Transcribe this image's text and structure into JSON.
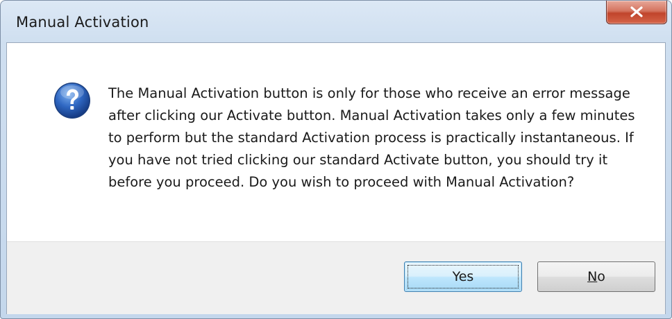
{
  "window": {
    "title": "Manual Activation"
  },
  "dialog": {
    "icon": "question-icon",
    "message": "The Manual Activation button is only for those who receive an error message after clicking our Activate button. Manual Activation takes only a few minutes to perform but the standard Activation process is practically instantaneous. If you have not tried clicking our standard Activate button, you should try it before you proceed. Do you wish to proceed with Manual Activation?"
  },
  "buttons": {
    "yes_label": "Yes",
    "no_mnemonic": "N",
    "no_rest": "o"
  },
  "colors": {
    "close_button": "#c0442b",
    "question_icon": "#2b5fb4",
    "default_button_border": "#3c7fb1"
  }
}
